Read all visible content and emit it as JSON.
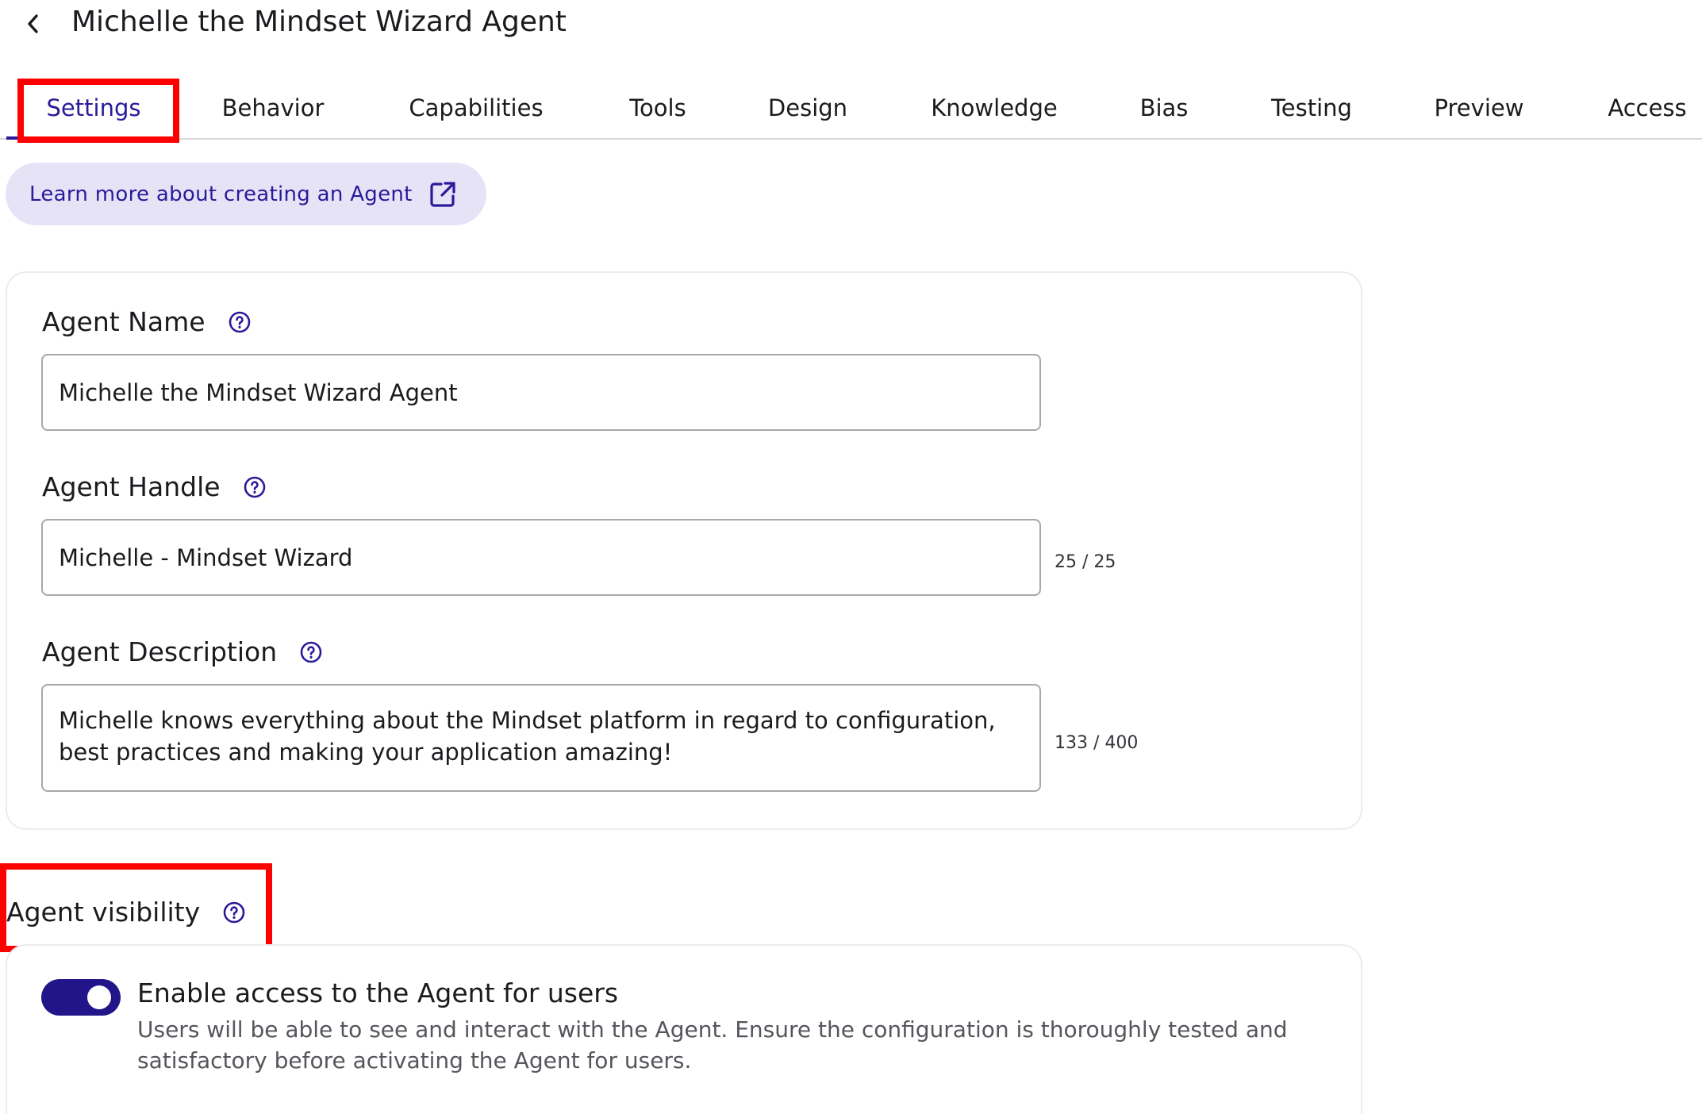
{
  "header": {
    "title": "Michelle the Mindset Wizard Agent",
    "back_icon": "chevron-left-icon"
  },
  "tabs": [
    {
      "label": "Settings",
      "active": true
    },
    {
      "label": "Behavior"
    },
    {
      "label": "Capabilities"
    },
    {
      "label": "Tools"
    },
    {
      "label": "Design"
    },
    {
      "label": "Knowledge"
    },
    {
      "label": "Bias"
    },
    {
      "label": "Testing"
    },
    {
      "label": "Preview"
    },
    {
      "label": "Access"
    }
  ],
  "learn_more": {
    "label": "Learn more about creating an Agent",
    "icon": "external-link-icon"
  },
  "form": {
    "name": {
      "label": "Agent Name",
      "value": "Michelle the Mindset Wizard Agent"
    },
    "handle": {
      "label": "Agent Handle",
      "value": "Michelle - Mindset Wizard",
      "counter": "25 / 25"
    },
    "description": {
      "label": "Agent Description",
      "value": "Michelle knows everything about the Mindset platform in regard to configuration, best practices and making your application amazing!",
      "counter": "133 / 400"
    }
  },
  "visibility": {
    "title": "Agent visibility",
    "toggle_on": true,
    "toggle_label": "Enable access to the Agent for users",
    "description": "Users will be able to see and interact with the Agent. Ensure the configuration is thoroughly tested and satisfactory before activating the Agent for users."
  },
  "colors": {
    "accent": "#2a1a9a",
    "toggle_on": "#22158a",
    "pill_bg": "#e6e3f6",
    "annotation": "#ff0000"
  }
}
